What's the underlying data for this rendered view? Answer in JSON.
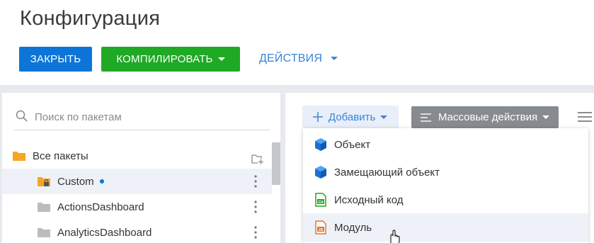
{
  "header": {
    "title": "Конфигурация",
    "close_label": "ЗАКРЫТЬ",
    "compile_label": "КОМПИЛИРОВАТЬ",
    "actions_label": "ДЕЙСТВИЯ"
  },
  "sidebar": {
    "search_placeholder": "Поиск по пакетам",
    "items": [
      {
        "label": "Все пакеты"
      },
      {
        "label": "Custom"
      },
      {
        "label": "ActionsDashboard"
      },
      {
        "label": "AnalyticsDashboard"
      }
    ]
  },
  "toolbar": {
    "add_label": "Добавить",
    "mass_actions_label": "Массовые действия"
  },
  "dropdown": {
    "items": [
      {
        "label": "Объект",
        "icon": "cube-icon"
      },
      {
        "label": "Замещающий объект",
        "icon": "cube-icon"
      },
      {
        "label": "Исходный код",
        "icon": "csharp-file-icon"
      },
      {
        "label": "Модуль",
        "icon": "js-file-icon"
      }
    ]
  },
  "colors": {
    "primary_blue": "#0d75d7",
    "compile_green": "#1fa925",
    "link_blue": "#3a84d8",
    "mass_gray": "#878a8e",
    "folder_orange": "#f5a623",
    "folder_gray": "#bcbcbc"
  }
}
